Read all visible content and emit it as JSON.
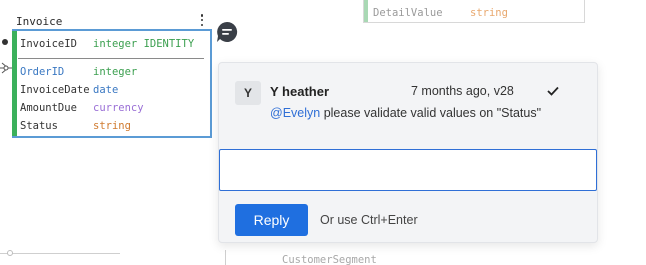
{
  "entity": {
    "title": "Invoice",
    "primary_key": {
      "name": "InvoiceID",
      "type": "integer IDENTITY"
    },
    "fields": [
      {
        "name": "OrderID",
        "type": "integer"
      },
      {
        "name": "InvoiceDate",
        "type": "date"
      },
      {
        "name": "AmountDue",
        "type": "currency"
      },
      {
        "name": "Status",
        "type": "string"
      }
    ]
  },
  "detail_entity": {
    "field": {
      "name": "DetailValue",
      "type": "string"
    }
  },
  "segment_entity": {
    "title": "CustomerSegment"
  },
  "comment": {
    "avatar_initial": "Y",
    "author": "Y heather",
    "meta": "7 months ago, v28",
    "mention": "@Evelyn",
    "text": " please validate valid values on \"Status\""
  },
  "reply": {
    "input_value": "",
    "button_label": "Reply",
    "hint": "Or use Ctrl+Enter"
  },
  "icons": {
    "more": "vertical-ellipsis-icon",
    "comment": "comment-bubble-icon",
    "resolve": "checkmark-icon"
  },
  "colors": {
    "accent": "#1f6fe0",
    "selection_border": "#5b9bd5",
    "entity_bar": "#3bb05b",
    "comment_badge": "#3a3f47"
  }
}
